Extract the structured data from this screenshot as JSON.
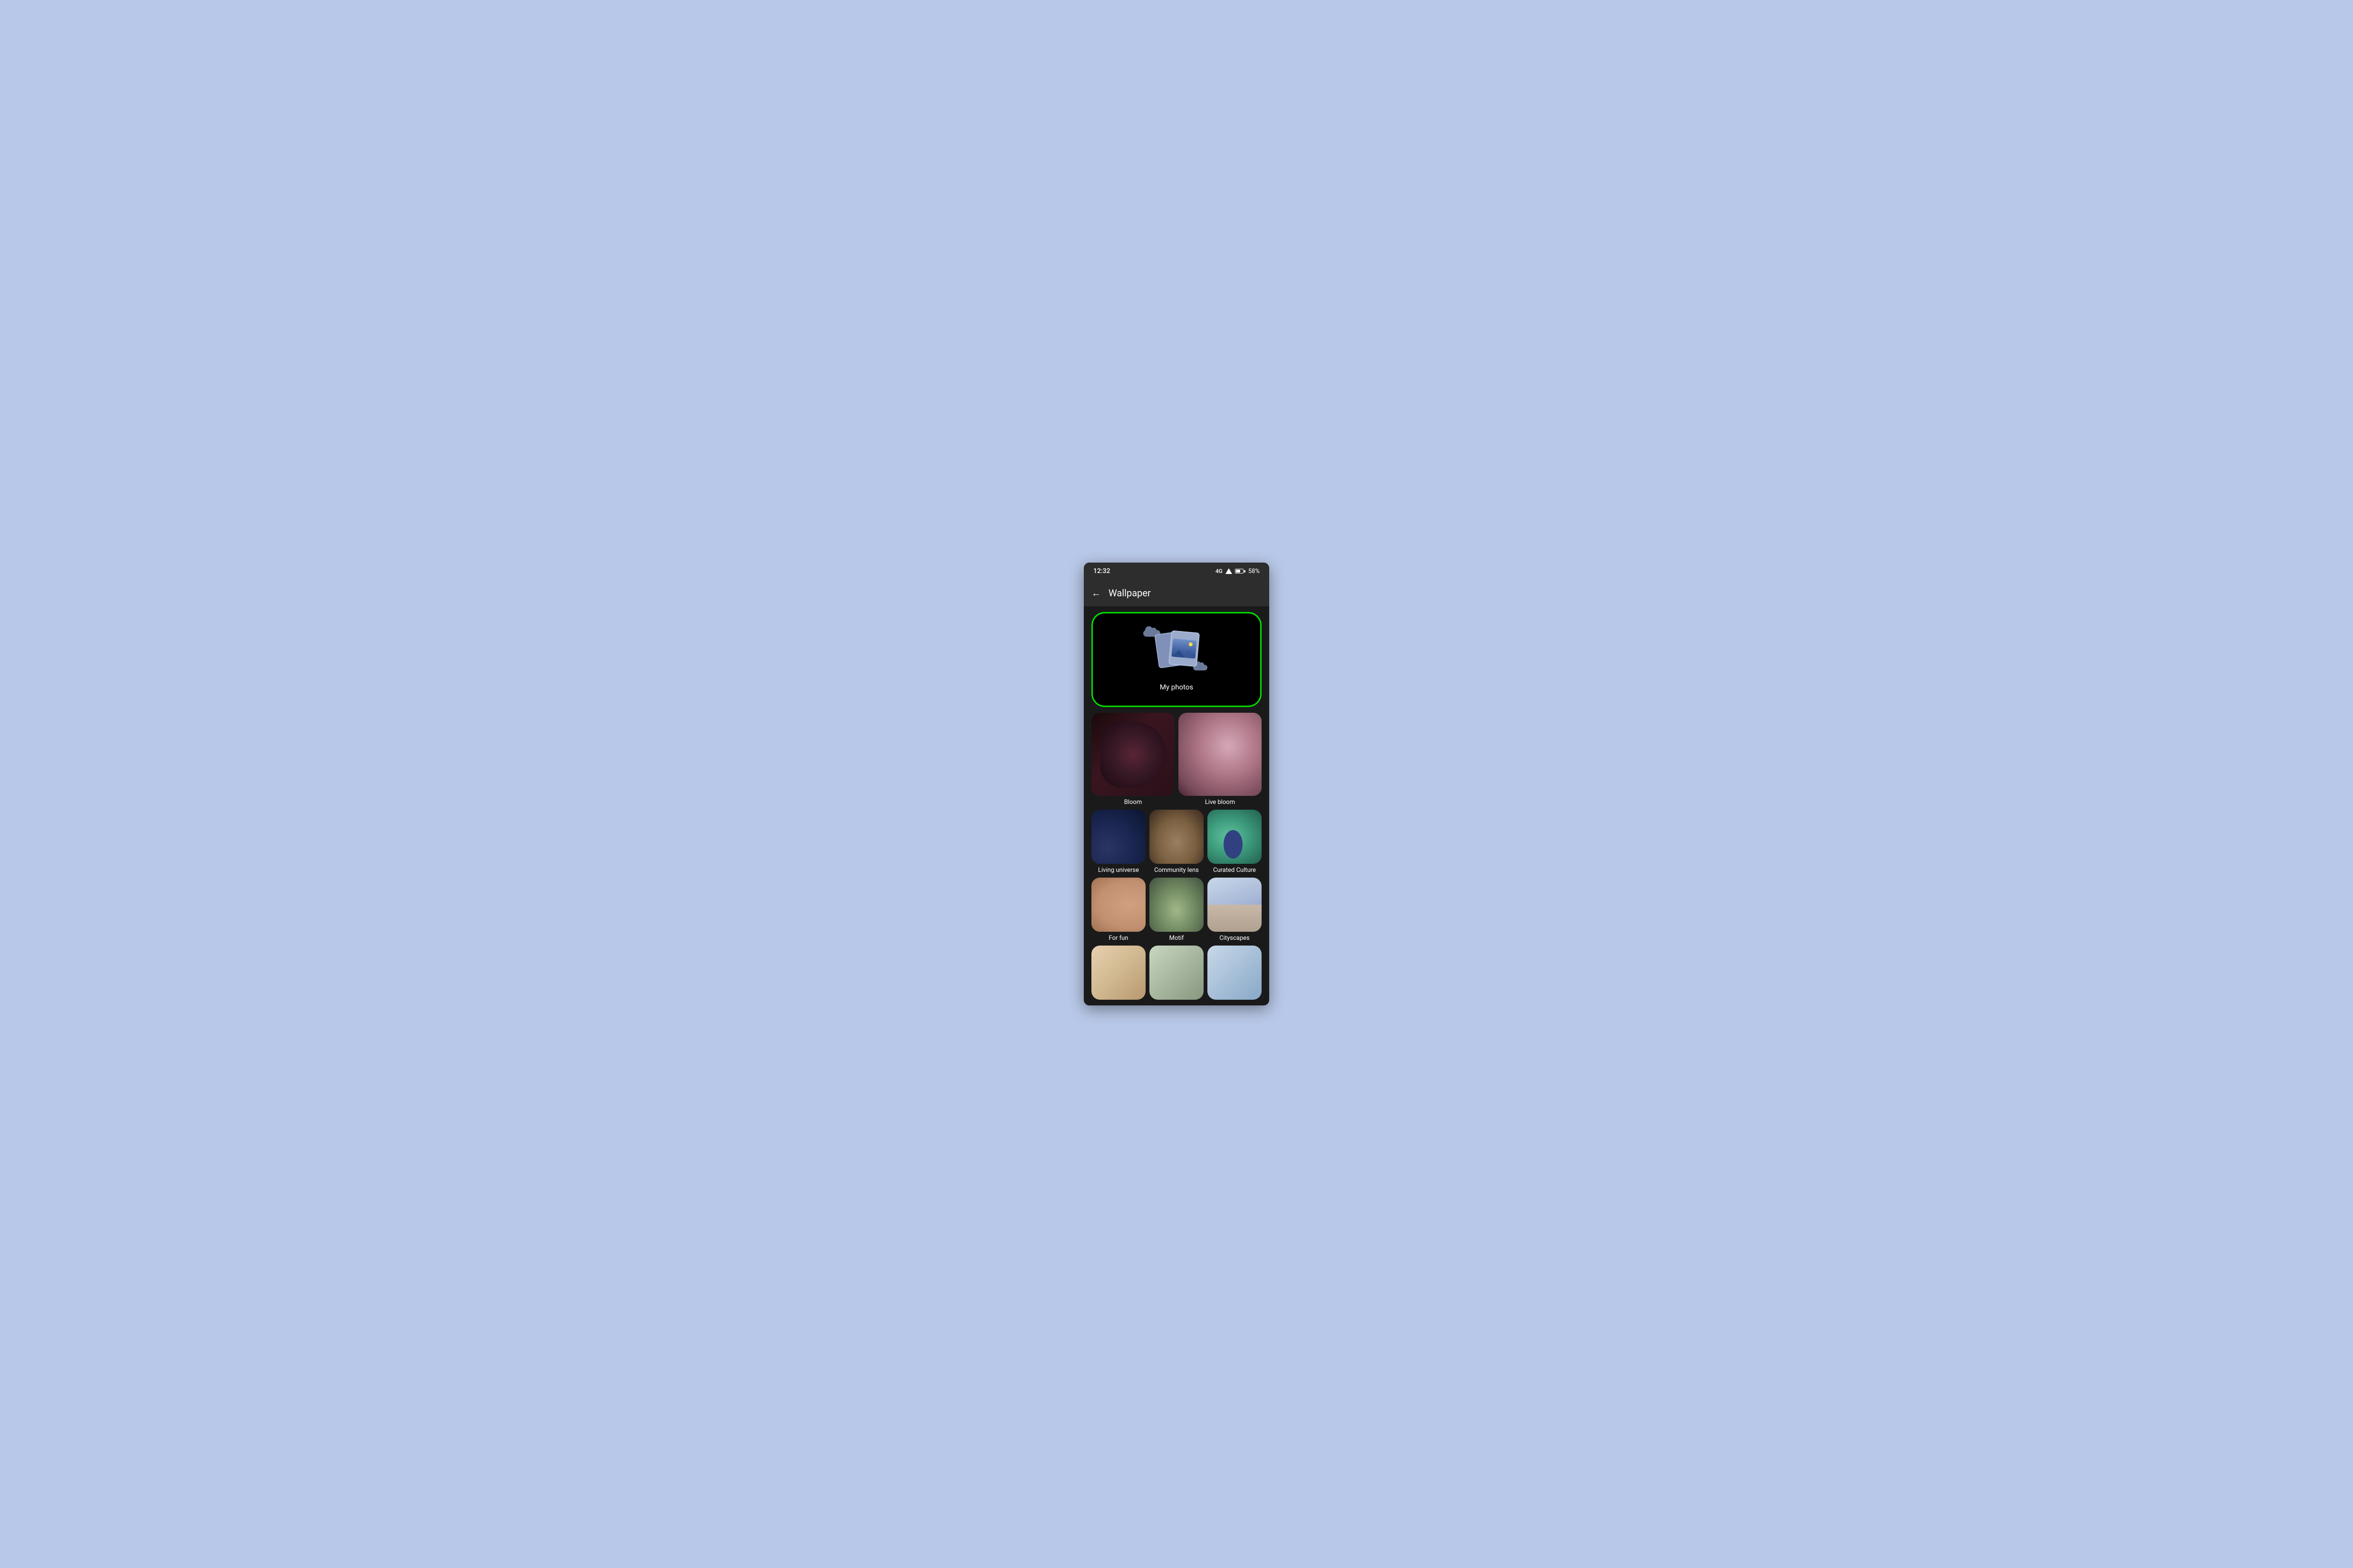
{
  "status_bar": {
    "time": "12:32",
    "network": "4G",
    "battery_percent": "58%"
  },
  "app_bar": {
    "back_label": "←",
    "title": "Wallpaper"
  },
  "my_photos": {
    "label": "My photos"
  },
  "wallpaper_items": [
    {
      "id": "bloom",
      "label": "Bloom"
    },
    {
      "id": "live-bloom",
      "label": "Live bloom"
    },
    {
      "id": "living-universe",
      "label": "Living universe"
    },
    {
      "id": "community-lens",
      "label": "Community lens"
    },
    {
      "id": "curated-culture",
      "label": "Curated Culture"
    },
    {
      "id": "for-fun",
      "label": "For fun"
    },
    {
      "id": "motif",
      "label": "Motif"
    },
    {
      "id": "cityscapes",
      "label": "Cityscapes"
    }
  ],
  "colors": {
    "background": "#b8c8e8",
    "phone_bg": "#1a1a1a",
    "status_bar_bg": "#2d2d2d",
    "app_bar_bg": "#2d2d2d",
    "selection_border": "#00e000",
    "text_white": "#ffffff"
  }
}
